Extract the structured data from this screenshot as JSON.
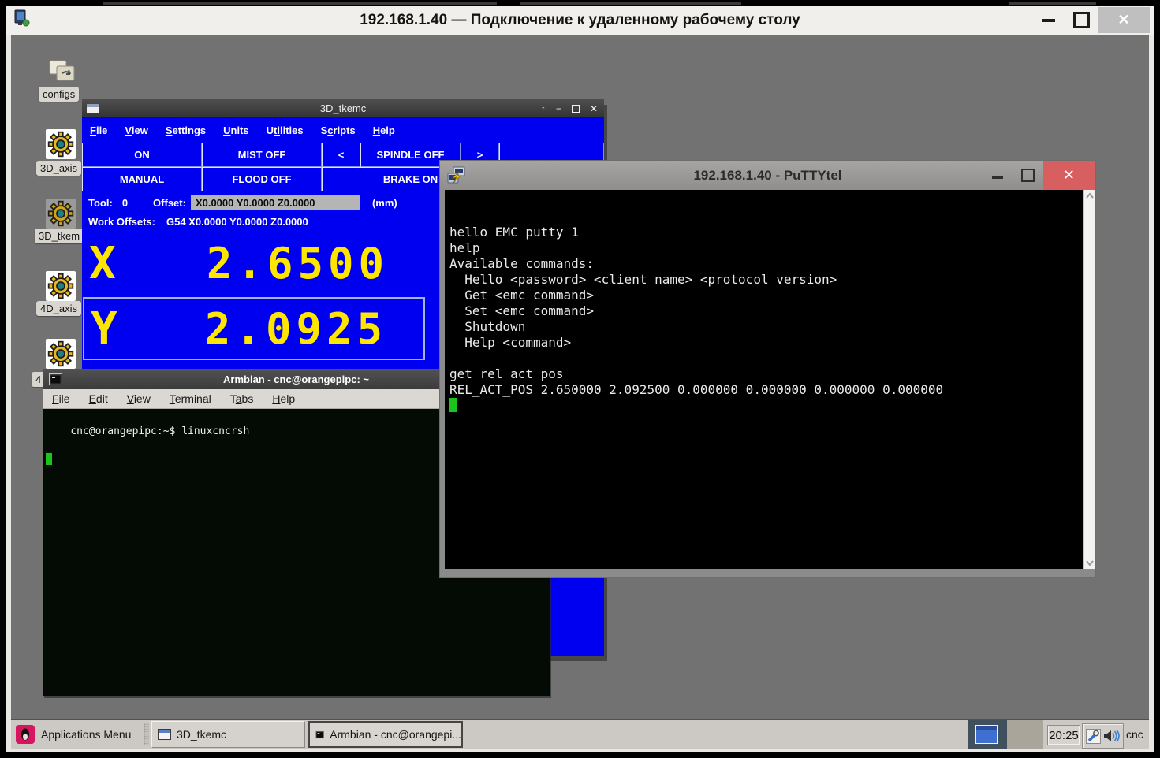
{
  "rdp_window": {
    "title": "192.168.1.40 — Подключение к удаленному рабочему столу"
  },
  "window_controls": {
    "shade": "↑",
    "minimize": "−",
    "close": "✕"
  },
  "colors": {
    "desktop_gray": "#727272",
    "tkemc_blue": "#0000f0",
    "dro_yellow": "#ffe600",
    "putty_close_red": "#d85f5f",
    "cursor_green": "#1ac41a"
  },
  "desktop": {
    "icons": [
      {
        "label": "configs",
        "type": "folder"
      },
      {
        "label": "3D_axis",
        "type": "gear"
      },
      {
        "label": "3D_tkem",
        "type": "gear"
      },
      {
        "label": "4D_axis",
        "type": "gear"
      },
      {
        "label": "4",
        "type": "gear"
      }
    ]
  },
  "tkemc": {
    "title": "3D_tkemc",
    "menu": [
      {
        "label": "File",
        "u": 0
      },
      {
        "label": "View",
        "u": 0
      },
      {
        "label": "Settings",
        "u": 0
      },
      {
        "label": "Units",
        "u": 0
      },
      {
        "label": "Utilities",
        "u": 1,
        "ulen": 2
      },
      {
        "label": "Scripts",
        "u": 1
      },
      {
        "label": "Help",
        "u": 0
      }
    ],
    "buttons": {
      "machine_on": "ON",
      "mist": "MIST OFF",
      "spindle_minus": "<",
      "spindle": "SPINDLE OFF",
      "spindle_plus": ">",
      "mode": "MANUAL",
      "flood": "FLOOD OFF",
      "brake": "BRAKE ON"
    },
    "tool_label": "Tool:",
    "tool_value": "0",
    "offset_label": "Offset:",
    "offset_value": "X0.0000 Y0.0000 Z0.0000",
    "units_label": "(mm)",
    "work_offsets_label": "Work Offsets:",
    "work_offsets_value": "G54 X0.0000 Y0.0000 Z0.0000",
    "axes": [
      {
        "name": "X",
        "value": "2.6500"
      },
      {
        "name": "Y",
        "value": "2.0925"
      }
    ]
  },
  "putty": {
    "title": "192.168.1.40 - PuTTYtel",
    "lines": [
      "hello EMC putty 1",
      "help",
      "Available commands:",
      "  Hello <password> <client name> <protocol version>",
      "  Get <emc command>",
      "  Set <emc command>",
      "  Shutdown",
      "  Help <command>",
      "",
      "get rel_act_pos",
      "REL_ACT_POS 2.650000 2.092500 0.000000 0.000000 0.000000 0.000000"
    ]
  },
  "armbian": {
    "title": "Armbian - cnc@orangepipc: ~",
    "menu": [
      {
        "label": "File",
        "u": 0
      },
      {
        "label": "Edit",
        "u": 0
      },
      {
        "label": "View",
        "u": 0
      },
      {
        "label": "Terminal",
        "u": 0
      },
      {
        "label": "Tabs",
        "u": 1
      },
      {
        "label": "Help",
        "u": 0
      }
    ],
    "prompt_line": "cnc@orangepipc:~$ linuxcncrsh"
  },
  "taskbar": {
    "apps_menu_label": "Applications Menu",
    "tasks": [
      {
        "label": "3D_tkemc",
        "active": false
      },
      {
        "label": "Armbian - cnc@orangepi...",
        "active": true
      }
    ],
    "clock": "20:25",
    "user_label": "cnc"
  }
}
